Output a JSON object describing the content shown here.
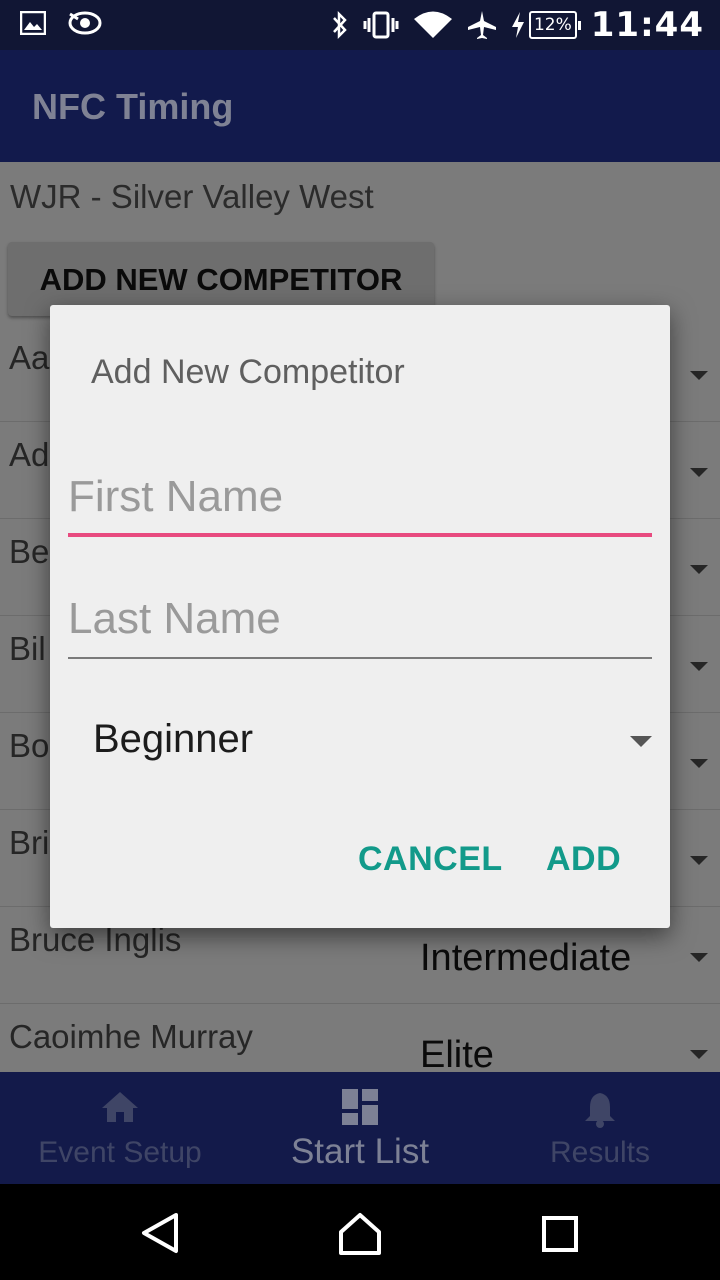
{
  "status_bar": {
    "time": "11:44",
    "battery": "12%",
    "icons": [
      "image-icon",
      "eye-icon",
      "bluetooth-icon",
      "vibrate-icon",
      "wifi-icon",
      "airplane-icon",
      "charging-icon",
      "battery-icon"
    ]
  },
  "app": {
    "title": "NFC Timing"
  },
  "event": {
    "name": "WJR - Silver Valley West",
    "add_button_label": "ADD NEW COMPETITOR"
  },
  "competitors": [
    {
      "name": "Aa",
      "level": ""
    },
    {
      "name": "Ad",
      "level": ""
    },
    {
      "name": "Be",
      "level": ""
    },
    {
      "name": "Bil",
      "level": ""
    },
    {
      "name": "Bo",
      "level": ""
    },
    {
      "name": "Bri",
      "level": ""
    },
    {
      "name": "Bruce Inglis",
      "level": "Intermediate"
    },
    {
      "name": "Caoimhe Murray",
      "level": "Elite"
    }
  ],
  "dialog": {
    "title": "Add New Competitor",
    "first_name": {
      "value": "",
      "placeholder": "First Name"
    },
    "last_name": {
      "value": "",
      "placeholder": "Last Name"
    },
    "level": {
      "selected": "Beginner"
    },
    "cancel_label": "CANCEL",
    "add_label": "ADD",
    "accent_color": "#129a8a",
    "focus_color": "#e84a7f"
  },
  "bottom_nav": {
    "items": [
      {
        "label": "Event Setup",
        "icon": "home-icon",
        "active": false
      },
      {
        "label": "Start List",
        "icon": "dashboard-icon",
        "active": true
      },
      {
        "label": "Results",
        "icon": "bell-icon",
        "active": false
      }
    ]
  },
  "system_nav": {
    "buttons": [
      "back-icon",
      "home-circle-icon",
      "recents-icon"
    ]
  }
}
